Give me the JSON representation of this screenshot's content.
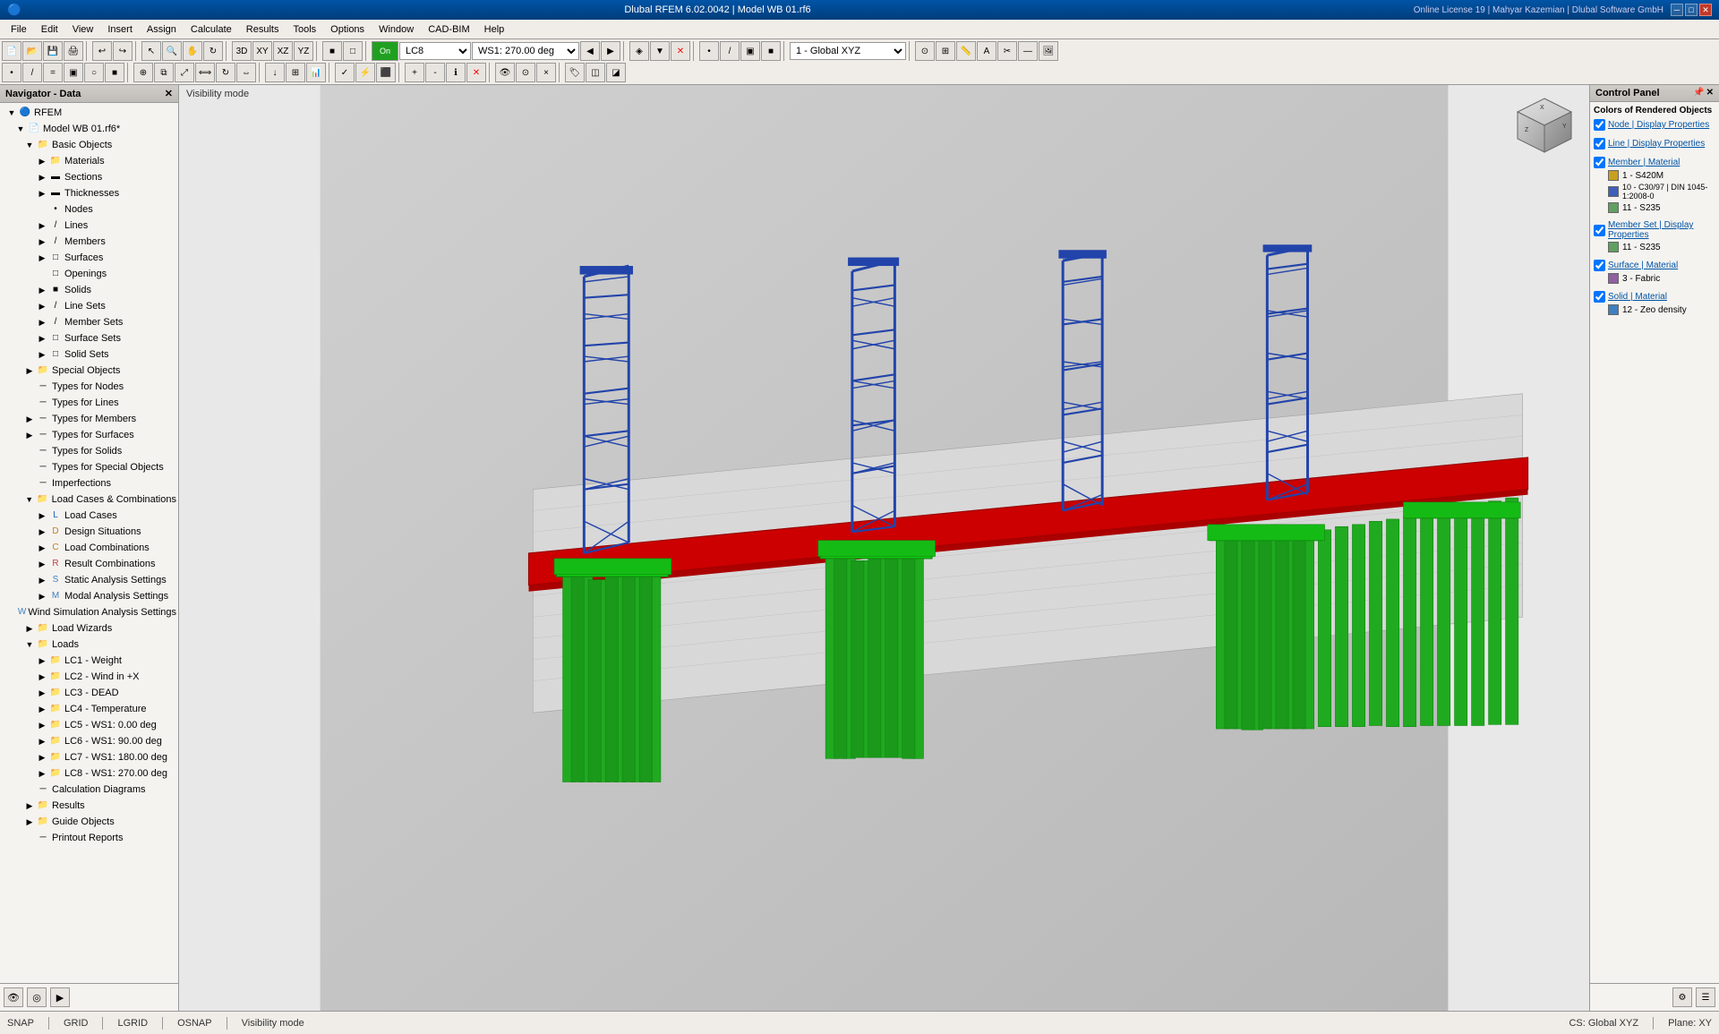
{
  "titleBar": {
    "title": "Dlubal RFEM 6.02.0042 | Model WB 01.rf6",
    "licenseInfo": "Online License 19 | Mahyar Kazemian | Dlubal Software GmbH",
    "buttons": [
      "─",
      "□",
      "✕"
    ]
  },
  "menuBar": {
    "items": [
      "File",
      "Edit",
      "View",
      "Insert",
      "Assign",
      "Calculate",
      "Results",
      "Tools",
      "Options",
      "Window",
      "CAD-BIM",
      "Help"
    ]
  },
  "toolbar": {
    "lcLabel": "LC8",
    "ws1Label": "WS1: 270.00 deg",
    "coordSystem": "1 - Global XYZ",
    "planeLabel": "Plane: XY"
  },
  "navigator": {
    "title": "Navigator - Data",
    "rfemLabel": "RFEM",
    "modelLabel": "Model WB 01.rf6*",
    "tree": [
      {
        "level": 1,
        "icon": "📁",
        "label": "Basic Objects",
        "expanded": true
      },
      {
        "level": 2,
        "icon": "📁",
        "label": "Materials",
        "expanded": false
      },
      {
        "level": 2,
        "icon": "─",
        "label": "Sections",
        "expanded": false
      },
      {
        "level": 2,
        "icon": "─",
        "label": "Thicknesses",
        "expanded": false
      },
      {
        "level": 2,
        "icon": "•",
        "label": "Nodes",
        "expanded": false
      },
      {
        "level": 2,
        "icon": "/",
        "label": "Lines",
        "expanded": false
      },
      {
        "level": 2,
        "icon": "/",
        "label": "Members",
        "expanded": false
      },
      {
        "level": 2,
        "icon": "□",
        "label": "Surfaces",
        "expanded": false
      },
      {
        "level": 2,
        "icon": "□",
        "label": "Openings",
        "expanded": false
      },
      {
        "level": 2,
        "icon": "■",
        "label": "Solids",
        "expanded": false
      },
      {
        "level": 2,
        "icon": "/",
        "label": "Line Sets",
        "expanded": false
      },
      {
        "level": 2,
        "icon": "/",
        "label": "Member Sets",
        "expanded": false
      },
      {
        "level": 2,
        "icon": "□",
        "label": "Surface Sets",
        "expanded": false
      },
      {
        "level": 2,
        "icon": "□",
        "label": "Solid Sets",
        "expanded": false
      },
      {
        "level": 1,
        "icon": "📁",
        "label": "Special Objects",
        "expanded": false
      },
      {
        "level": 1,
        "icon": "─",
        "label": "Types for Nodes",
        "expanded": false
      },
      {
        "level": 1,
        "icon": "─",
        "label": "Types for Lines",
        "expanded": false
      },
      {
        "level": 1,
        "icon": "─",
        "label": "Types for Members",
        "expanded": false
      },
      {
        "level": 1,
        "icon": "─",
        "label": "Types for Surfaces",
        "expanded": false
      },
      {
        "level": 1,
        "icon": "─",
        "label": "Types for Solids",
        "expanded": false
      },
      {
        "level": 1,
        "icon": "─",
        "label": "Types for Special Objects",
        "expanded": false
      },
      {
        "level": 1,
        "icon": "─",
        "label": "Imperfections",
        "expanded": false
      },
      {
        "level": 1,
        "icon": "📁",
        "label": "Load Cases & Combinations",
        "expanded": true
      },
      {
        "level": 2,
        "icon": "L",
        "label": "Load Cases",
        "expanded": false
      },
      {
        "level": 2,
        "icon": "D",
        "label": "Design Situations",
        "expanded": false
      },
      {
        "level": 2,
        "icon": "C",
        "label": "Load Combinations",
        "expanded": false
      },
      {
        "level": 2,
        "icon": "R",
        "label": "Result Combinations",
        "expanded": false
      },
      {
        "level": 2,
        "icon": "S",
        "label": "Static Analysis Settings",
        "expanded": false
      },
      {
        "level": 2,
        "icon": "M",
        "label": "Modal Analysis Settings",
        "expanded": false
      },
      {
        "level": 2,
        "icon": "W",
        "label": "Wind Simulation Analysis Settings",
        "expanded": false
      },
      {
        "level": 1,
        "icon": "📁",
        "label": "Load Wizards",
        "expanded": false
      },
      {
        "level": 1,
        "icon": "📁",
        "label": "Loads",
        "expanded": true
      },
      {
        "level": 2,
        "icon": "📁",
        "label": "LC1 - Weight",
        "expanded": false
      },
      {
        "level": 2,
        "icon": "📁",
        "label": "LC2 - Wind in +X",
        "expanded": false
      },
      {
        "level": 2,
        "icon": "📁",
        "label": "LC3 - DEAD",
        "expanded": false
      },
      {
        "level": 2,
        "icon": "📁",
        "label": "LC4 - Temperature",
        "expanded": false
      },
      {
        "level": 2,
        "icon": "📁",
        "label": "LC5 - WS1: 0.00 deg",
        "expanded": false
      },
      {
        "level": 2,
        "icon": "📁",
        "label": "LC6 - WS1: 90.00 deg",
        "expanded": false
      },
      {
        "level": 2,
        "icon": "📁",
        "label": "LC7 - WS1: 180.00 deg",
        "expanded": false
      },
      {
        "level": 2,
        "icon": "📁",
        "label": "LC8 - WS1: 270.00 deg",
        "expanded": false
      },
      {
        "level": 1,
        "icon": "─",
        "label": "Calculation Diagrams",
        "expanded": false
      },
      {
        "level": 1,
        "icon": "📁",
        "label": "Results",
        "expanded": false
      },
      {
        "level": 1,
        "icon": "📁",
        "label": "Guide Objects",
        "expanded": false
      },
      {
        "level": 1,
        "icon": "─",
        "label": "Printout Reports",
        "expanded": false
      }
    ]
  },
  "viewport": {
    "headerText": "Visibility mode"
  },
  "controlPanel": {
    "title": "Control Panel",
    "mainTitle": "Colors of Rendered Objects",
    "sections": [
      {
        "title": "Node | Display Properties",
        "items": []
      },
      {
        "title": "Line | Display Properties",
        "items": []
      },
      {
        "title": "Member | Material",
        "items": [
          {
            "color": "#c8a020",
            "label": "1 - S420M"
          },
          {
            "color": "#6080c0",
            "label": "10 - C30/37 | DIN 1045-1:2008-0"
          },
          {
            "color": "#60a060",
            "label": "11 - S235"
          }
        ]
      },
      {
        "title": "Member Set | Display Properties",
        "items": [
          {
            "color": "#60a060",
            "label": "11 - S235"
          }
        ]
      },
      {
        "title": "Surface | Material",
        "items": [
          {
            "color": "#9060a0",
            "label": "3 - Fabric"
          }
        ]
      },
      {
        "title": "Solid | Material",
        "items": [
          {
            "color": "#4080c0",
            "label": "12 - Zeo density"
          }
        ]
      }
    ]
  },
  "statusBar": {
    "items": [
      "SNAP",
      "GRID",
      "LGRID",
      "OSNAP",
      "Visibility mode"
    ],
    "coordSystem": "CS: Global XYZ",
    "plane": "Plane: XY"
  },
  "navBottomIcons": [
    "👁",
    "📷",
    "🎥"
  ]
}
